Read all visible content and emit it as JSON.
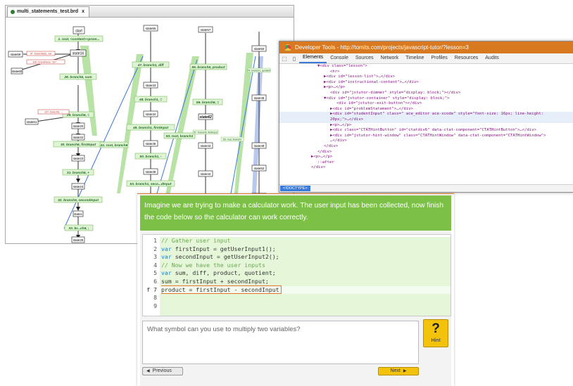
{
  "graph_window": {
    "tab_title": "multi_statements_test.brd",
    "close_glyph": "x",
    "nodes": {
      "start": "start",
      "state16": "state16",
      "state59": "state59",
      "state60": "state60",
      "state61": "state61",
      "state20": "state20",
      "state22": "state22",
      "state23": "state23",
      "state24": "state24",
      "statec": "statec",
      "state26": "state26",
      "state55": "state55",
      "state33": "state33",
      "state34": "state34",
      "state36": "state36",
      "state38": "state38",
      "state57": "state57",
      "state41": "state41",
      "state42": "state42",
      "state43": "state43",
      "state44": "state44",
      "state50": "state50",
      "state48": "state48",
      "state49": "state49",
      "state52": "state52",
      "state51": "state51"
    },
    "edges": {
      "e1": "1. root, <content><prom...",
      "e28": "28. branch6, sum",
      "e29": "29. branch6, =",
      "e30": "30. branch6, firstInput",
      "e31": "31. branch6, +",
      "e32": "32. branch6, secondInput",
      "e33": "33. br...ch6, ;",
      "e47": "47. branch1, diff",
      "e48": "48. branch1, =",
      "e49": "49. branch1, firstInput",
      "e50": "50. branch1, -",
      "e51": "51. root, branch1",
      "e53": "53. branch1, seco...dInput",
      "e55": "55. branch5, product",
      "e56": "56. branch5, =",
      "e41": "41. root, branch6",
      "e93": "93. root, branch1",
      "err1": "97. branchless, var",
      "err2": "100. branchless, \"{\\n\"...",
      "err3": "107. branch6, ...",
      "small1": "74. branch1, quotient",
      "small2": "57. branch5, firstInput",
      "small3": "59. root, branch2"
    }
  },
  "devtools": {
    "title": "Developer Tools - http://tomits.com/projects/javascript-tutor/?lesson=3",
    "tabs": [
      "Elements",
      "Console",
      "Sources",
      "Network",
      "Timeline",
      "Profiles",
      "Resources",
      "Audits"
    ],
    "active_tab": "Elements",
    "tree": [
      {
        "indent": 6,
        "text": "▼<div class=\"lesson\">",
        "sel": false
      },
      {
        "indent": 8,
        "text": "<hr>",
        "sel": false
      },
      {
        "indent": 7,
        "text": "▶<div id=\"lesson-list\">…</div>",
        "sel": false
      },
      {
        "indent": 7,
        "text": "▶<div id=\"instructional-content\">…</div>",
        "sel": false
      },
      {
        "indent": 7,
        "text": "▶<p>…</p>",
        "sel": false
      },
      {
        "indent": 8,
        "text": "<div id=\"jstutor-dimmer\" style=\"display: block;\"></div>",
        "sel": false
      },
      {
        "indent": 7,
        "text": "▼<div id=\"jstutor-container\" style=\"display: block;\">",
        "sel": false
      },
      {
        "indent": 9,
        "text": "<div id=\"jstutor-exit-button\"></div>",
        "sel": false
      },
      {
        "indent": 8,
        "text": "▶<div id=\"problemStatement\">…</div>",
        "sel": false
      },
      {
        "indent": 8,
        "text": "▶<div id=\"studentInput\" class=\" ace_editor ace-xcode\" style=\"font-size: 16px; line-height:",
        "sel": true
      },
      {
        "indent": 8,
        "text": "20px;\">…</div>",
        "sel": true
      },
      {
        "indent": 8,
        "text": "▶<p>…</p>",
        "sel": false
      },
      {
        "indent": 8,
        "text": "▶<div class=\"CTATHintButton\" id=\"ctatdiv6\" data-ctat-component=\"CTATHintButton\">…</div>",
        "sel": false
      },
      {
        "indent": 8,
        "text": "▶<div id=\"jstutor-hint-window\" class=\"CTATHintWindow\" data-ctat-component=\"CTATHintWindow\">",
        "sel": false
      },
      {
        "indent": 8,
        "text": "…</div>",
        "sel": false
      },
      {
        "indent": 7,
        "text": "</div>",
        "sel": false
      },
      {
        "indent": 6,
        "text": "</div>",
        "sel": false
      },
      {
        "indent": 5,
        "text": "▶<p>…</p>",
        "sel": false
      },
      {
        "indent": 6,
        "text": "::after",
        "sel": false
      },
      {
        "indent": 5,
        "text": "</div>",
        "sel": false
      }
    ],
    "breadcrumb": "<!DOCTYPE>"
  },
  "tutor": {
    "instruction": "Imagine we are trying to make a calculator work. The user input has been collected, now finish the code below so the calculator can work correctly.",
    "code_lines": [
      {
        "n": "1",
        "code": "// Gather user input"
      },
      {
        "n": "2",
        "code": "var firstInput = getUserInput1();"
      },
      {
        "n": "3",
        "code": "var secondInput = getUserInput2();"
      },
      {
        "n": "4",
        "code": "// Now we have the user inputs"
      },
      {
        "n": "5",
        "code": "var sum, diff, product, quotient;"
      },
      {
        "n": "6",
        "code": "sum = firstInput + secondInput;"
      },
      {
        "n": "7",
        "code": "product = firstInput - secondInput"
      },
      {
        "n": "8",
        "code": ""
      },
      {
        "n": "9",
        "code": ""
      }
    ],
    "active_line_marker": "f",
    "hint_text": "What symbol can you use to multiply two variables?",
    "hint_button": {
      "glyph": "?",
      "label": "Hint"
    },
    "previous_label": "Previous",
    "next_label": "Next",
    "colors": {
      "instruction_bg": "#7cc146",
      "code_bg": "#e5f7d8",
      "hint_button": "#f3c20b"
    }
  }
}
